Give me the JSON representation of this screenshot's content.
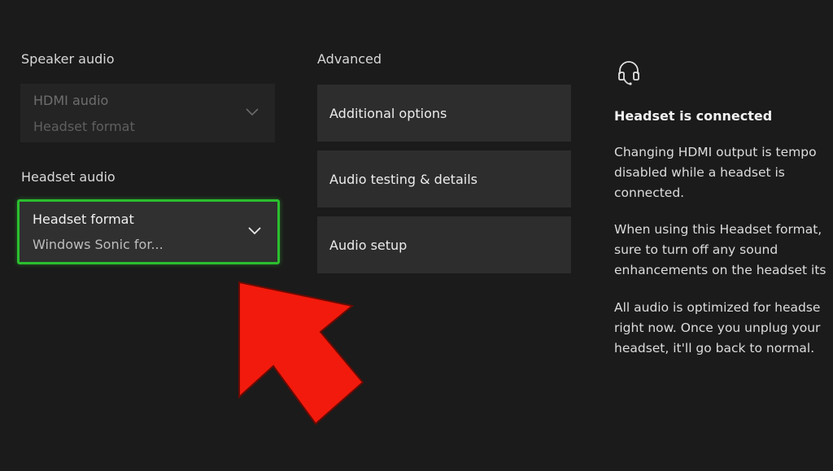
{
  "speaker_audio": {
    "title": "Speaker audio",
    "value": "HDMI audio",
    "format": "Headset format"
  },
  "headset_audio": {
    "title": "Headset audio",
    "label": "Headset format",
    "value": "Windows Sonic for..."
  },
  "advanced": {
    "title": "Advanced",
    "buttons": [
      {
        "label": "Additional options"
      },
      {
        "label": "Audio testing & details"
      },
      {
        "label": "Audio setup"
      }
    ]
  },
  "info_panel": {
    "icon": "headset-icon",
    "title": "Headset is connected",
    "paragraphs": [
      [
        "Changing HDMI output is tempo",
        "disabled while a headset is",
        "connected."
      ],
      [
        "When using this Headset format,",
        "sure to turn off any sound",
        "enhancements on the headset its"
      ],
      [
        "All audio is optimized for headse",
        "right now. Once you unplug your",
        "headset, it'll go back to normal."
      ]
    ]
  },
  "colors": {
    "background": "#1b1b1b",
    "focus_border": "#2bbf2f",
    "annotation_arrow": "#f21a0c"
  }
}
